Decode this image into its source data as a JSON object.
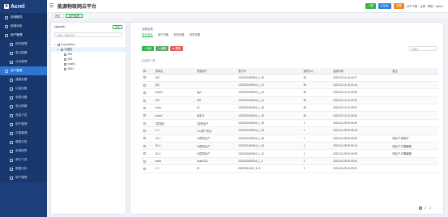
{
  "app": {
    "brand": "Acrel",
    "title": "能源物联网云平台"
  },
  "topbar": {
    "buttons": [
      "一键",
      "云后台",
      "设置"
    ],
    "links": [
      "APP下载",
      "全屏",
      "帮助",
      "admin"
    ]
  },
  "tabs": [
    "首页",
    "用户管理"
  ],
  "sidebar": {
    "items": [
      {
        "label": "用电概况",
        "type": "group"
      },
      {
        "label": "用电分析",
        "type": "group"
      },
      {
        "label": "用户管理",
        "type": "group"
      },
      {
        "label": "网关管理",
        "type": "sub"
      },
      {
        "label": "表计配置",
        "type": "sub"
      },
      {
        "label": "分区管理",
        "type": "sub"
      },
      {
        "label": "用户管理",
        "type": "active"
      },
      {
        "label": "通道设置",
        "type": "sub"
      },
      {
        "label": "计量设备",
        "type": "sub"
      },
      {
        "label": "电表设置",
        "type": "sub"
      },
      {
        "label": "电价策略",
        "type": "sub"
      },
      {
        "label": "电量下发",
        "type": "sub"
      },
      {
        "label": "用户管理",
        "type": "sub"
      },
      {
        "label": "欠费管理",
        "type": "sub"
      },
      {
        "label": "缴费记录",
        "type": "sub"
      },
      {
        "label": "电费报表",
        "type": "sub"
      },
      {
        "label": "单价下发",
        "type": "sub"
      },
      {
        "label": "数据分析",
        "type": "sub"
      },
      {
        "label": "用户管理",
        "type": "sub"
      }
    ]
  },
  "left": {
    "title": "xiguanlu",
    "add": "添加",
    "search_placeholder": "请输入搜索内容",
    "tree": [
      {
        "label": "b-up-edeco",
        "level": 0,
        "sel": false
      },
      {
        "label": "杂费区",
        "level": 1,
        "sel": true
      },
      {
        "label": "220",
        "level": 2,
        "sel": false
      },
      {
        "label": "202",
        "level": 2,
        "sel": false
      },
      {
        "label": "room2",
        "level": 2,
        "sel": false
      },
      {
        "label": "1001",
        "level": 2,
        "sel": false
      }
    ]
  },
  "right": {
    "crumb": "当前区域",
    "tabs": [
      "基本信息",
      "用户设备",
      "电表设备",
      "电表设置"
    ],
    "actions": [
      "+ 添加",
      "✎ 编辑",
      "✖ 删除"
    ],
    "search_placeholder": "请输入",
    "selinfo": "已选择 0 项",
    "cols": [
      "",
      "房间名",
      "所属用户",
      "表计号",
      "面积(m²)",
      "缴费时间",
      "备注"
    ],
    "rows": [
      [
        "201",
        "",
        "1201200100914_1_20",
        "50",
        "2022-03-14 16:41:07",
        ""
      ],
      [
        "202",
        "",
        "1201200100914_1_21",
        "50",
        "2022-03-14 16:41:44",
        ""
      ],
      [
        "room2",
        "xgzl",
        "1201200100914_1_13",
        "50",
        "2022-03-14 13:23:05",
        ""
      ],
      [
        "220",
        "220",
        "1201200100914_1_12",
        "50",
        "2022-03-14 13:22:52",
        ""
      ],
      [
        "room",
        "12",
        "1201200100914_1_16",
        "50",
        "2022-03-14 13:25:57",
        ""
      ],
      [
        "room1",
        "杂支11",
        "1201200100914_1_19",
        "50",
        "2022-03-14 13:26:26",
        ""
      ],
      [
        "1层商业",
        "1层商业户",
        "1201200100914_1_35",
        "1",
        "2022-04-25 09:28:30",
        ""
      ],
      [
        "1-1",
        "1-1用户-商业",
        "1201200100914_1_33",
        "1",
        "2022-04-25 09:28:18",
        ""
      ],
      [
        "10-1",
        "10层商业户",
        "1201200100914_1_30",
        "1",
        "2022-04-25 09:28:35",
        "商业户-房颜卡"
      ],
      [
        "10-2",
        "10层商业户",
        "1201200100914_1_34",
        "1",
        "2022-04-25 09:29:16",
        "商业户-不要编辑"
      ],
      [
        "10-3",
        "10层商业户",
        "1201200100914_1_31",
        "1",
        "2022-04-25 09:29:35",
        "商业户-不要编辑"
      ],
      [
        "room",
        "room1111",
        "1201200100914_1_1",
        "1",
        "2022-04-25 09:29:40",
        ""
      ],
      [
        "1-1",
        "22",
        "20220314132_11-3",
        "1",
        "2022-04-25 13:09:22",
        ""
      ]
    ],
    "pager": [
      "‹",
      "1",
      "2",
      "3",
      "›"
    ]
  }
}
